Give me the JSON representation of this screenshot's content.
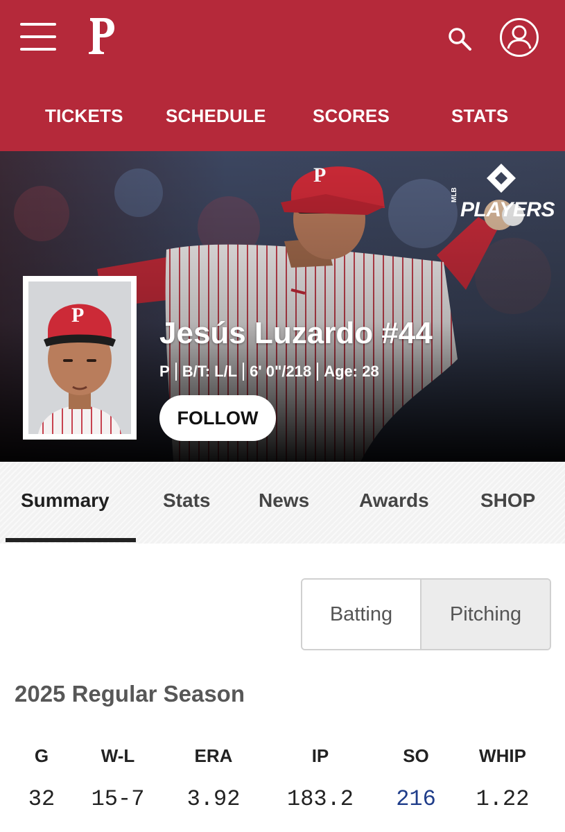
{
  "header": {
    "menu_icon": "hamburger-menu-icon",
    "logo_letter": "P",
    "search_icon": "search-icon",
    "account_icon": "user-account-icon",
    "nav": [
      "TICKETS",
      "SCHEDULE",
      "SCORES",
      "STATS"
    ]
  },
  "hero": {
    "badge_mlb": "MLB",
    "badge_players": "PLAYERS",
    "name": "Jesús Luzardo #44",
    "meta": {
      "position": "P",
      "bats_throws": "B/T: L/L",
      "height_weight": "6' 0\"/218",
      "age": "Age: 28"
    },
    "follow_label": "FOLLOW"
  },
  "tabs": {
    "items": [
      "Summary",
      "Stats",
      "News",
      "Awards",
      "SHOP"
    ],
    "active": "Summary"
  },
  "toggle": {
    "batting": "Batting",
    "pitching": "Pitching",
    "selected": "Pitching"
  },
  "season": {
    "title": "2025 Regular Season",
    "headers": [
      "G",
      "W-L",
      "ERA",
      "IP",
      "SO",
      "WHIP"
    ],
    "values": [
      "32",
      "15-7",
      "3.92",
      "183.2",
      "216",
      "1.22"
    ]
  },
  "colors": {
    "brand_red": "#b5293a",
    "link_blue": "#1f3d8a"
  }
}
